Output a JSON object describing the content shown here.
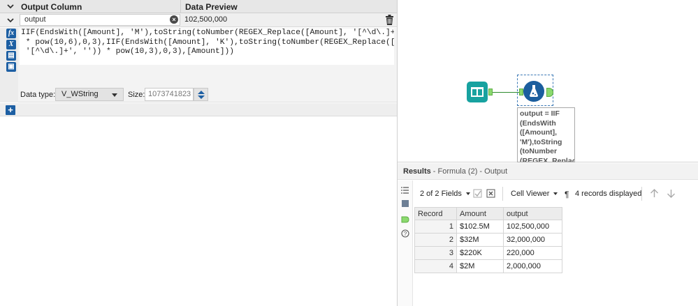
{
  "formula_panel": {
    "header": {
      "output_column_label": "Output Column",
      "data_preview_label": "Data Preview"
    },
    "row": {
      "output_value": "output",
      "preview_value": "102,500,000"
    },
    "expression_lines": [
      "IIF(EndsWith([Amount], 'M'),toString(toNumber(REGEX_Replace([Amount], '[^\\d\\.]+', ''))",
      " * pow(10,6),0,3),IIF(EndsWith([Amount], 'K'),toString(toNumber(REGEX_Replace([Amount],",
      " '[^\\d\\.]+', '')) * pow(10,3),0,3),[Amount]))"
    ],
    "data_type_label": "Data type:",
    "data_type_value": "V_WString",
    "size_label": "Size:",
    "size_value": "1073741823",
    "gutter_icons": [
      "fx-icon",
      "variable-icon",
      "saved-expression-icon",
      "save-icon"
    ]
  },
  "canvas": {
    "annotation": "output = IIF\n(EndsWith\n([Amount],\n'M'),toString\n(toNumber\n(REGEX_Replace",
    "colors": {
      "input_tool": "#17a2a0",
      "formula_tool": "#1b5e9e",
      "connection": "#2e8b2e"
    }
  },
  "results": {
    "title": "Results",
    "subtitle": " - Formula (2) - Output",
    "fields_label": "2 of 2 Fields",
    "viewer_label": "Cell Viewer",
    "records_label": "4 records displayed",
    "columns": [
      "Record",
      "Amount",
      "output"
    ],
    "rows": [
      [
        "1",
        "$102.5M",
        "102,500,000"
      ],
      [
        "2",
        "$32M",
        "32,000,000"
      ],
      [
        "3",
        "$220K",
        "220,000"
      ],
      [
        "4",
        "$2M",
        "2,000,000"
      ]
    ]
  }
}
